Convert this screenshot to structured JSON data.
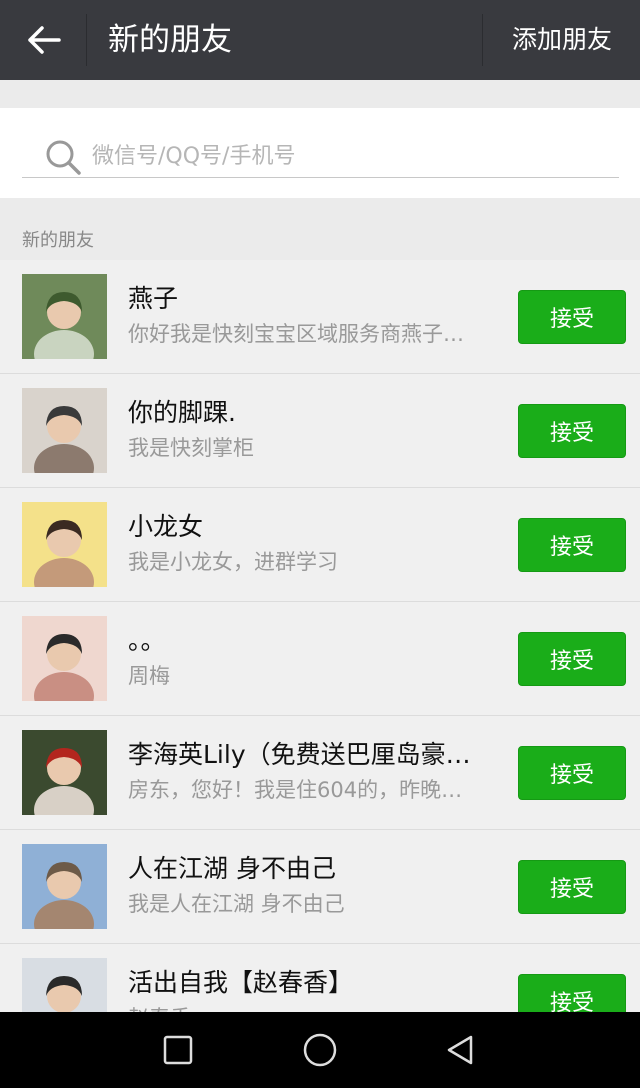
{
  "header": {
    "title": "新的朋友",
    "add_friend_label": "添加朋友",
    "back_icon": "back-arrow-icon"
  },
  "search": {
    "placeholder": "微信号/QQ号/手机号",
    "icon": "search-icon"
  },
  "section": {
    "title": "新的朋友"
  },
  "requests": [
    {
      "name": "燕子",
      "message": "你好我是快刻宝宝区域服务商燕子…",
      "button": "接受",
      "avatar_colors": [
        "#6f8a5a",
        "#c9d4c0",
        "#3e5a2e"
      ]
    },
    {
      "name": "你的脚踝.",
      "message": "我是快刻掌柜",
      "button": "接受",
      "avatar_colors": [
        "#d9d3cc",
        "#8c7a6e",
        "#3a3a3a"
      ]
    },
    {
      "name": "小龙女",
      "message": "我是小龙女，进群学习",
      "button": "接受",
      "avatar_colors": [
        "#f4e18a",
        "#c49a7a",
        "#3a2a22"
      ]
    },
    {
      "name": "。。",
      "message": "周梅",
      "button": "接受",
      "avatar_colors": [
        "#efd7cf",
        "#c98f83",
        "#2a2a2a"
      ]
    },
    {
      "name": "李海英Lily（免费送巴厘岛豪…",
      "message": "房东，您好！我是住604的，昨晚…",
      "button": "接受",
      "avatar_colors": [
        "#3b4a2f",
        "#d8d0c6",
        "#b3261e"
      ]
    },
    {
      "name": "人在江湖 身不由己",
      "message": "我是人在江湖 身不由己",
      "button": "接受",
      "avatar_colors": [
        "#8fb0d6",
        "#a48670",
        "#6d5a48"
      ]
    },
    {
      "name": "活出自我【赵春香】",
      "message": "赵春香",
      "button": "接受",
      "avatar_colors": [
        "#d8dde3",
        "#a35a4f",
        "#2a2a2a"
      ]
    }
  ],
  "navbar": {
    "buttons": [
      "square-recents-icon",
      "circle-home-icon",
      "triangle-back-icon"
    ]
  }
}
